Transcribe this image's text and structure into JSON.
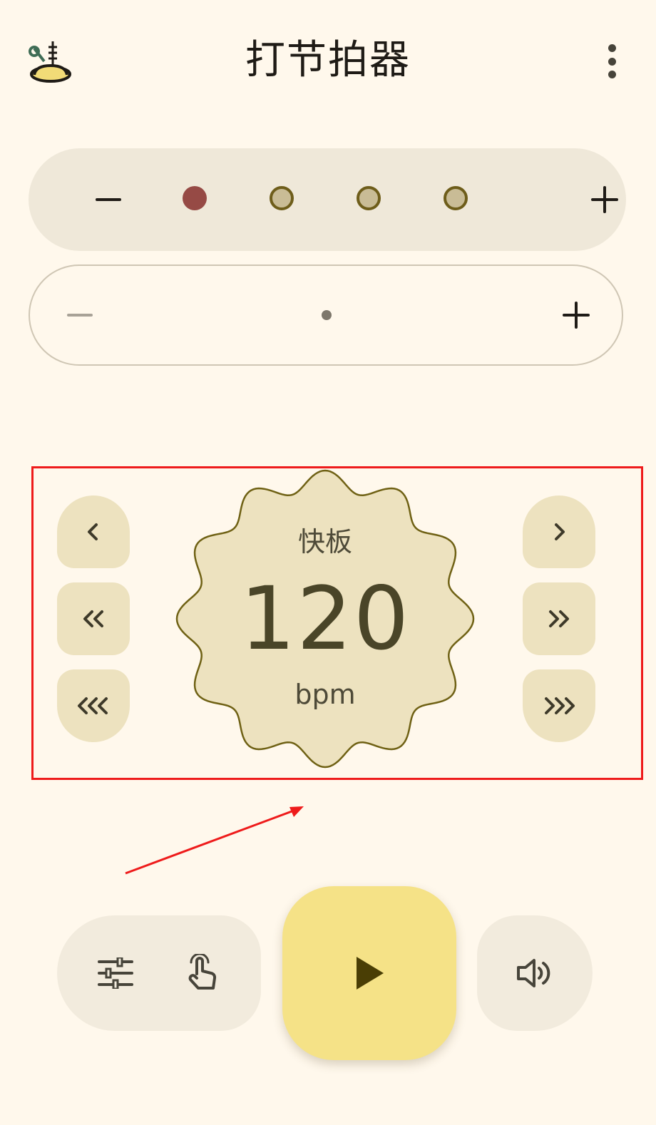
{
  "app": {
    "title": "打节拍器"
  },
  "beats": {
    "count": 4,
    "pattern": [
      "accent",
      "normal",
      "normal",
      "normal"
    ]
  },
  "subdivision": {
    "count": 1
  },
  "tempo": {
    "name": "快板",
    "value": "120",
    "unit": "bpm"
  },
  "colors": {
    "background": "#fff8ec",
    "accent_beat": "#964a45",
    "normal_beat": "#c9bc96",
    "dial_fill": "#ede2bf",
    "play_button": "#f5e287",
    "annotation": "#ee1b1b"
  },
  "icons": {
    "logo": "metronome-logo-icon",
    "more": "more-vert-icon",
    "settings": "tune-icon",
    "tap": "touch-icon",
    "play": "play-icon",
    "sound": "volume-icon"
  }
}
